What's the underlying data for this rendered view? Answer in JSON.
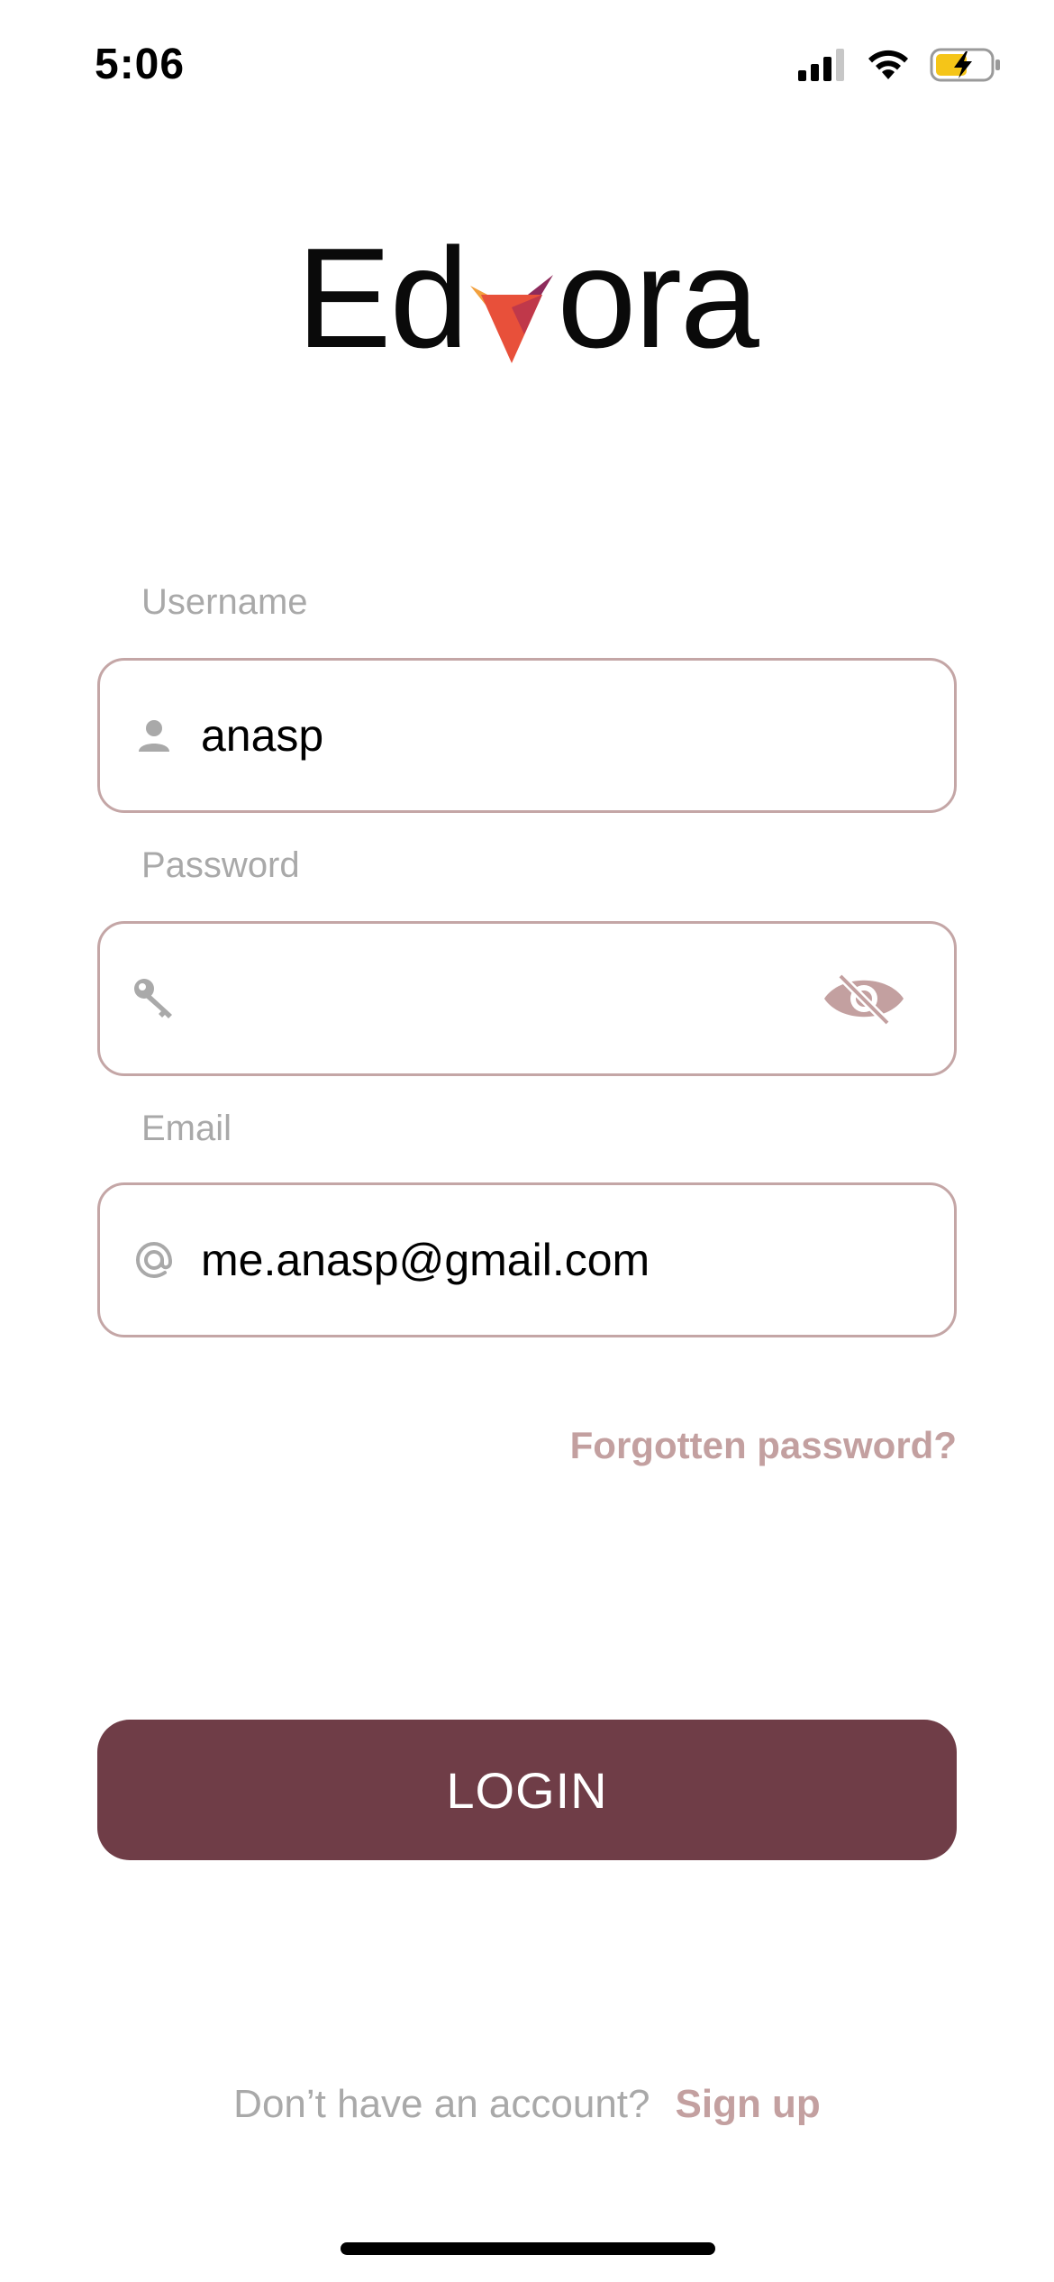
{
  "status_bar": {
    "time": "5:06",
    "icons": [
      "cellular-signal-icon",
      "wifi-icon",
      "battery-charging-icon"
    ]
  },
  "logo": {
    "prefix": "Ed",
    "suffix": "ora",
    "mark_colors": [
      "#f2a03d",
      "#e8503a",
      "#8e2b5b"
    ]
  },
  "form": {
    "username": {
      "label": "Username",
      "value": "anasp",
      "icon": "person-icon"
    },
    "password": {
      "label": "Password",
      "value": "",
      "icon": "key-icon",
      "toggle_icon": "eye-slash-icon"
    },
    "email": {
      "label": "Email",
      "value": "me.anasp@gmail.com",
      "icon": "at-sign-icon"
    },
    "forgot_label": "Forgotten password?"
  },
  "login_button": "LOGIN",
  "signup": {
    "prompt": "Don’t have an account?",
    "link": "Sign up"
  },
  "colors": {
    "accent": "#6f3d47",
    "muted_accent": "#c3a0a0",
    "field_border": "#c4a6a6",
    "label_gray": "#a9a9a9"
  }
}
